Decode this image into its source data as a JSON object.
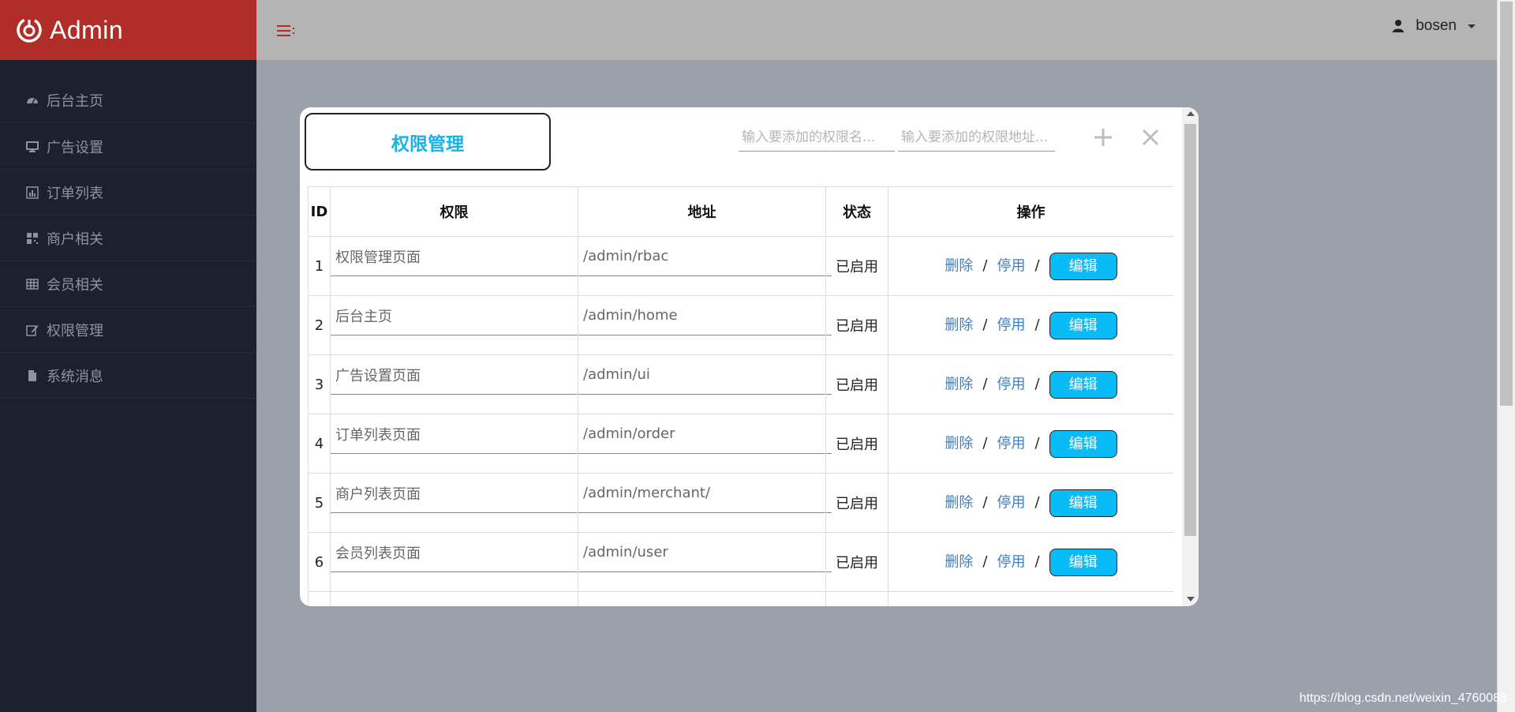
{
  "brand": {
    "name": "Admin"
  },
  "sidebar": {
    "items": [
      {
        "label": "后台主页",
        "icon": "dashboard-icon"
      },
      {
        "label": "广告设置",
        "icon": "desktop-icon"
      },
      {
        "label": "订单列表",
        "icon": "bar-chart-icon"
      },
      {
        "label": "商户相关",
        "icon": "qrcode-icon"
      },
      {
        "label": "会员相关",
        "icon": "table-icon"
      },
      {
        "label": "权限管理",
        "icon": "edit-icon"
      },
      {
        "label": "系统消息",
        "icon": "file-icon"
      }
    ]
  },
  "header": {
    "username": "bosen"
  },
  "modal": {
    "title": "权限管理",
    "name_placeholder": "输入要添加的权限名...",
    "url_placeholder": "输入要添加的权限地址...",
    "columns": [
      "ID",
      "权限",
      "地址",
      "状态",
      "操作"
    ],
    "rows": [
      {
        "id": "1",
        "name": "权限管理页面",
        "url": "/admin/rbac",
        "status": "已启用"
      },
      {
        "id": "2",
        "name": "后台主页",
        "url": "/admin/home",
        "status": "已启用"
      },
      {
        "id": "3",
        "name": "广告设置页面",
        "url": "/admin/ui",
        "status": "已启用"
      },
      {
        "id": "4",
        "name": "订单列表页面",
        "url": "/admin/order",
        "status": "已启用"
      },
      {
        "id": "5",
        "name": "商户列表页面",
        "url": "/admin/merchant/",
        "status": "已启用"
      },
      {
        "id": "6",
        "name": "会员列表页面",
        "url": "/admin/user",
        "status": "已启用"
      },
      {
        "id": "",
        "name": "",
        "url": "",
        "status": ""
      }
    ],
    "ops": {
      "delete": "删除",
      "disable": "停用",
      "separator": "/",
      "edit": "编辑"
    }
  },
  "watermark": "https://blog.csdn.net/weixin_4760088",
  "colors": {
    "brand": "#b12e28",
    "sidebar": "#1c2130",
    "accent": "#09bbf6",
    "title": "#1ab2e6",
    "link": "#3f7fbf"
  }
}
